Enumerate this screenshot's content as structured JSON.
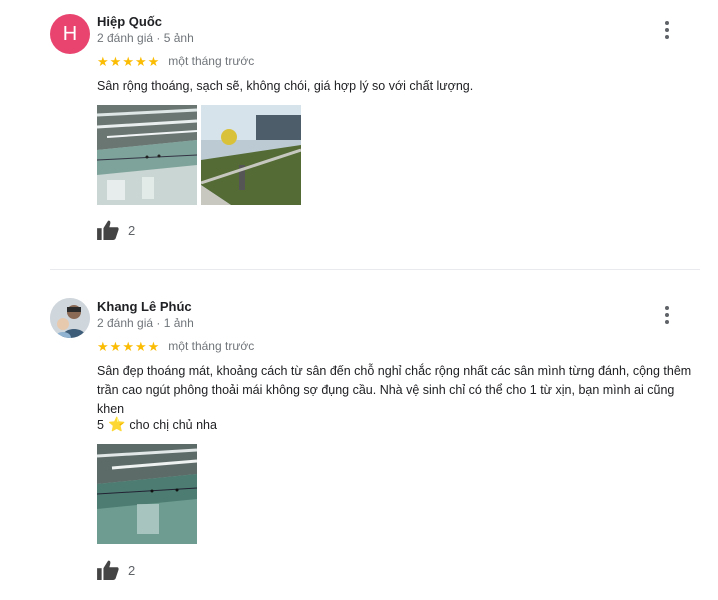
{
  "reviews": [
    {
      "avatar_letter": "H",
      "name": "Hiệp Quốc",
      "meta": "2 đánh giá · 5 ảnh",
      "rating": 5,
      "time": "một tháng trước",
      "text": "Sân rộng thoáng, sạch sẽ, không chói, giá hợp lý so với chất lượng.",
      "likes": "2"
    },
    {
      "name": "Khang Lê Phúc",
      "meta": "2 đánh giá · 1 ảnh",
      "rating": 5,
      "time": "một tháng trước",
      "text": "Sân đẹp thoáng mát, khoảng cách từ sân đến chỗ nghỉ chắc rộng nhất các sân mình từng đánh, cộng thêm trần cao ngút phông thoải mái không sợ đụng cầu. Nhà vệ sinh chỉ có thể cho 1 từ xịn, bạn mình ai cũng khen",
      "extra_number": "5",
      "extra_text": "cho chị chủ nha",
      "likes": "2"
    }
  ],
  "icons": {
    "star": "star-icon",
    "menu": "more-vert-icon",
    "like": "thumb-up-icon"
  },
  "colors": {
    "star": "#fbbc04",
    "avatar_h": "#e8446f",
    "meta": "#70757a"
  }
}
